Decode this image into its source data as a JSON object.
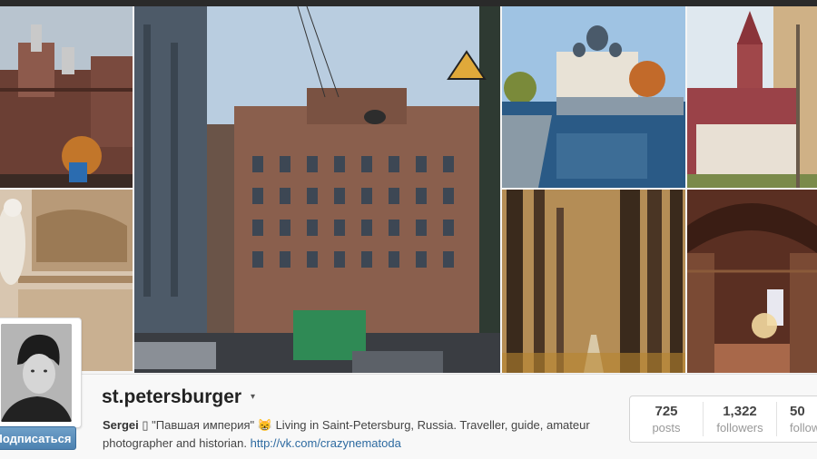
{
  "profile": {
    "username": "st.petersburger",
    "menu_caret": "▾",
    "follow_button": "Подписаться",
    "bio_name": "Sergei",
    "bio_symbol": "▯",
    "bio_text": " \"Павшая империя\" 😸 Living in Saint-Petersburg, Russia. Traveller, guide, amateur photographer and historian. ",
    "bio_link": "http://vk.com/crazynematoda"
  },
  "stats": [
    {
      "value": "725",
      "label": "posts"
    },
    {
      "value": "1,322",
      "label": "followers"
    },
    {
      "value": "50",
      "label": "follow"
    }
  ],
  "colors": {
    "follow_button": "#4d82b1",
    "link": "#2d6aa0",
    "top_bar": "#2a2a2a"
  }
}
